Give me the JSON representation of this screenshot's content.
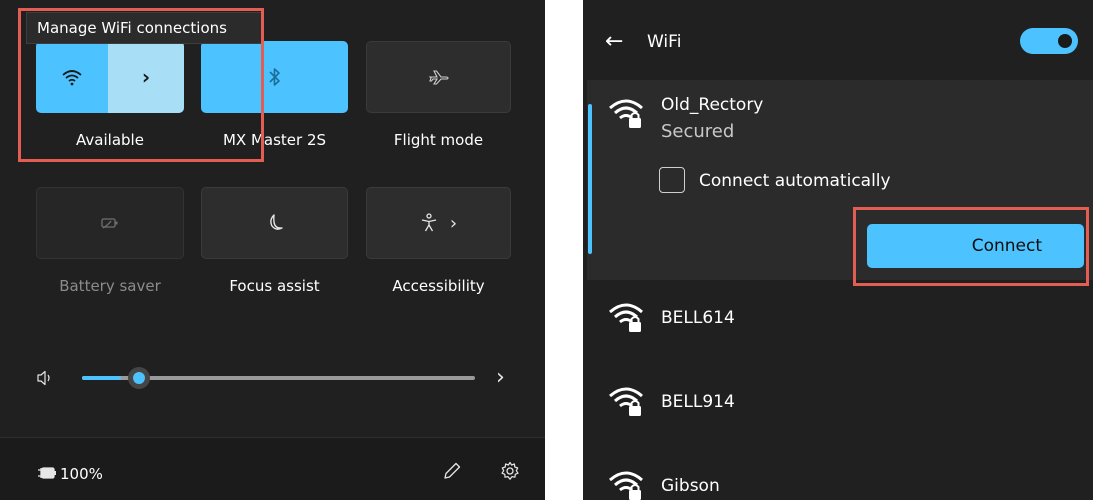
{
  "quick_settings": {
    "tooltip": "Manage WiFi connections",
    "tiles": [
      {
        "id": "wifi",
        "label": "Available",
        "icon": "wifi-icon",
        "state": "on"
      },
      {
        "id": "bluetooth",
        "label": "MX Master 2S",
        "icon": "bluetooth-icon",
        "state": "on"
      },
      {
        "id": "flight",
        "label": "Flight mode",
        "icon": "airplane-icon",
        "state": "off"
      },
      {
        "id": "battery-saver",
        "label": "Battery saver",
        "icon": "battery-saver-icon",
        "state": "disabled"
      },
      {
        "id": "focus",
        "label": "Focus assist",
        "icon": "moon-icon",
        "state": "off"
      },
      {
        "id": "accessibility",
        "label": "Accessibility",
        "icon": "accessibility-icon",
        "state": "off"
      }
    ],
    "volume": {
      "icon": "speaker-icon",
      "level": 0.1
    },
    "footer": {
      "battery_text": "100%"
    }
  },
  "wifi_panel": {
    "title": "WiFi",
    "toggle_on": true,
    "networks": [
      {
        "name": "Old_Rectory",
        "status": "Secured",
        "expanded": true
      },
      {
        "name": "BELL614"
      },
      {
        "name": "BELL914"
      },
      {
        "name": "Gibson"
      }
    ],
    "connect_automatically_label": "Connect automatically",
    "connect_label": "Connect"
  },
  "colors": {
    "accent": "#4cc2ff",
    "highlight": "#e35d53",
    "panel": "#202020"
  }
}
